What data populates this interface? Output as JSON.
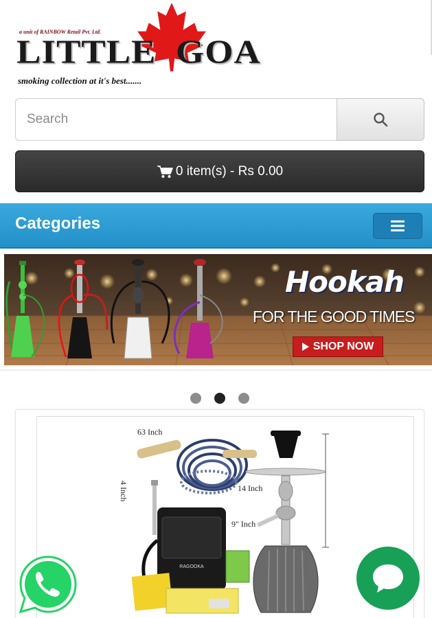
{
  "logo": {
    "tagline_top": "a unit of RAINBOW Retail Pvt. Ltd.",
    "name_left": "LITTLE",
    "name_right": "GOA",
    "tagline_bottom": "smoking collection at it's best.......",
    "leaf_color": "#e01818"
  },
  "search": {
    "placeholder": "Search",
    "value": "",
    "button_icon": "search-icon"
  },
  "cart": {
    "icon": "cart-icon",
    "label": "0 item(s) - Rs 0.00"
  },
  "categories": {
    "title": "Categories",
    "menu_icon": "hamburger-icon"
  },
  "banner": {
    "headline": "Hookah",
    "tagline": "FOR THE GOOD TIMES",
    "cta_label": "SHOP NOW"
  },
  "carousel": {
    "dot_count": 3,
    "active_index": 1
  },
  "product": {
    "labels": {
      "hose_length": "63 Inch",
      "tongs_length": "4 Inch",
      "stem_height": "14 Inch",
      "base_height": "9\" Inch"
    }
  },
  "floating": {
    "whatsapp_icon": "whatsapp-icon",
    "chat_icon": "chat-icon"
  },
  "colors": {
    "accent_blue": "#2a9bd3",
    "cart_bar": "#333333",
    "cta_red": "#c81d1d",
    "whatsapp_green": "#25d366",
    "chat_green": "#18a057"
  }
}
